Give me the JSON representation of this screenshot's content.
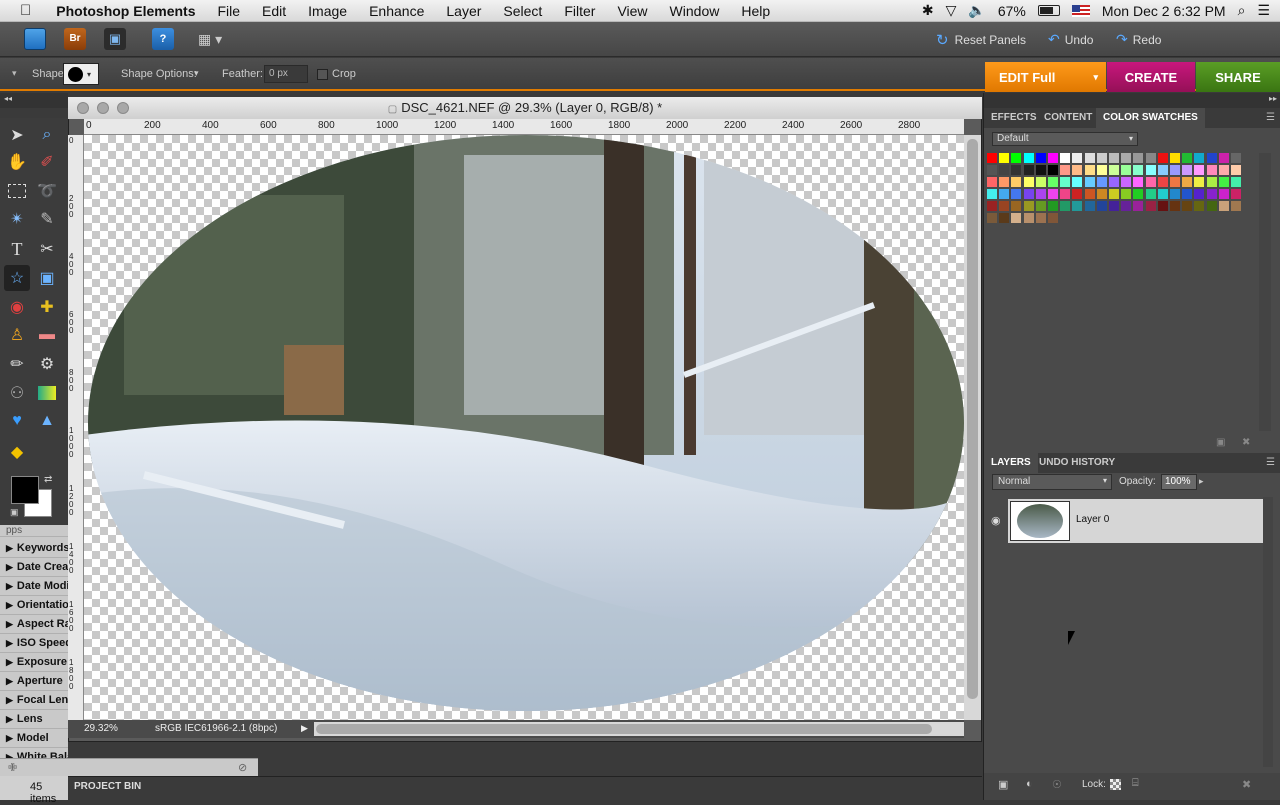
{
  "menubar": {
    "apple": "",
    "app_name": "Photoshop Elements",
    "items": [
      "File",
      "Edit",
      "Image",
      "Enhance",
      "Layer",
      "Select",
      "Filter",
      "View",
      "Window",
      "Help"
    ],
    "battery": "67%",
    "datetime": "Mon Dec 2  6:32 PM"
  },
  "toolbar": {
    "reset_panels": "Reset Panels",
    "undo": "Undo",
    "redo": "Redo"
  },
  "options": {
    "shape_label": "Shape:",
    "shape_options_label": "Shape Options:",
    "feather_label": "Feather:",
    "feather_value": "0 px",
    "crop_label": "Crop"
  },
  "modes": {
    "edit": "EDIT Full",
    "create": "CREATE",
    "share": "SHARE"
  },
  "document": {
    "title": "DSC_4621.NEF @ 29.3% (Layer 0, RGB/8) *",
    "zoom": "29.32%",
    "profile": "sRGB IEC61966-2.1 (8bpc)",
    "ruler_h": [
      "0",
      "200",
      "400",
      "600",
      "800",
      "1000",
      "1200",
      "1400",
      "1600",
      "1800",
      "2000",
      "2200",
      "2400",
      "2600",
      "2800"
    ],
    "ruler_v": [
      "0",
      "200",
      "400",
      "600",
      "800",
      "1000",
      "1200",
      "1400",
      "1600",
      "1800"
    ]
  },
  "left_list": {
    "partial_top": "pps",
    "items": [
      "Keywords",
      "Date Created",
      "Date Modified",
      "Orientation",
      "Aspect Ratio",
      "ISO Speed",
      "Exposure",
      "Aperture",
      "Focal Length",
      "Lens",
      "Model",
      "White Balance"
    ],
    "count": "45 items"
  },
  "project_bin": "PROJECT BIN",
  "right_panel": {
    "tabs": [
      "EFFECTS",
      "CONTENT",
      "COLOR SWATCHES"
    ],
    "swatch_set": "Default",
    "swatch_colors": [
      [
        "#ff0000",
        "#ffff00",
        "#00ff00",
        "#00ffff",
        "#0000ff",
        "#ff00ff",
        "#ffffff",
        "#eeeeee",
        "#dddddd",
        "#cccccc",
        "#bbbbbb",
        "#aaaaaa",
        "#999999",
        "#888888",
        "#ee1111",
        "#ffdd00",
        "#22bb33",
        "#11aacc",
        "#2244cc",
        "#cc22aa",
        "#666666"
      ],
      [
        "#555555",
        "#444444",
        "#333333",
        "#222222",
        "#111111",
        "#000000",
        "#ff9988",
        "#ffbb88",
        "#ffdd88",
        "#ffff99",
        "#ccff99",
        "#99ff99",
        "#88ffcc",
        "#88ffff",
        "#88ccff",
        "#9999ff",
        "#cc99ff",
        "#ff99ff",
        "#ff88bb",
        "#ffaaaa",
        "#ffccaa"
      ],
      [
        "#ff6666",
        "#ff9966",
        "#ffcc66",
        "#ffff66",
        "#ccff66",
        "#66ff66",
        "#66ffcc",
        "#66ffff",
        "#66ccff",
        "#6699ff",
        "#9966ff",
        "#cc66ff",
        "#ff66ff",
        "#ff66aa",
        "#ee4444",
        "#ee7744",
        "#eeaa44",
        "#eeee44",
        "#aaee44",
        "#44ee44",
        "#44eeaa"
      ],
      [
        "#44eeee",
        "#44aaee",
        "#4477ee",
        "#7744ee",
        "#aa44ee",
        "#ee44ee",
        "#ee4488",
        "#cc2222",
        "#cc5522",
        "#cc8822",
        "#cccc22",
        "#88cc22",
        "#22cc22",
        "#22cc88",
        "#22cccc",
        "#2288cc",
        "#2255cc",
        "#5522cc",
        "#8822cc",
        "#cc22cc",
        "#cc2266"
      ],
      [
        "#992222",
        "#994422",
        "#996622",
        "#999922",
        "#669922",
        "#229922",
        "#229966",
        "#229999",
        "#226699",
        "#224499",
        "#442299",
        "#662299",
        "#992299",
        "#992244",
        "#661111",
        "#663311",
        "#664411",
        "#666611",
        "#446611",
        "#c9a27a",
        "#a07850"
      ],
      [
        "#7a5a3a",
        "#5a3a1a",
        "#d4b08c",
        "#b8906c",
        "#9c7250",
        "#805638"
      ]
    ],
    "layers_tabs": [
      "LAYERS",
      "UNDO HISTORY"
    ],
    "blend_mode": "Normal",
    "opacity_label": "Opacity:",
    "opacity_value": "100%",
    "layer_name": "Layer 0",
    "lock_label": "Lock:"
  }
}
